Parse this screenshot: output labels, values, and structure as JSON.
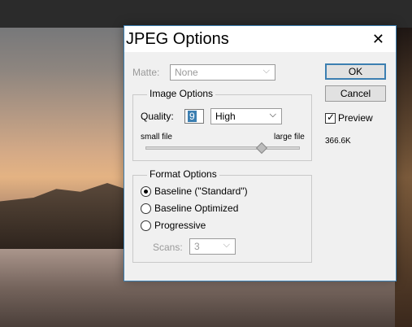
{
  "dialog": {
    "title": "JPEG Options",
    "close_symbol": "✕"
  },
  "matte": {
    "label": "Matte:",
    "value": "None"
  },
  "image_options": {
    "legend": "Image Options",
    "quality_label": "Quality:",
    "quality_value": "9",
    "quality_preset": "High",
    "small_label": "small file",
    "large_label": "large file",
    "slider_fraction": 0.75
  },
  "format_options": {
    "legend": "Format Options",
    "options": [
      "Baseline (\"Standard\")",
      "Baseline Optimized",
      "Progressive"
    ],
    "selected_index": 0,
    "scans_label": "Scans:",
    "scans_value": "3"
  },
  "buttons": {
    "ok": "OK",
    "cancel": "Cancel"
  },
  "preview": {
    "label": "Preview",
    "checked": true,
    "file_size": "366.6K"
  },
  "icons": {
    "dropdown": "chevron-down-icon",
    "close": "close-icon"
  }
}
